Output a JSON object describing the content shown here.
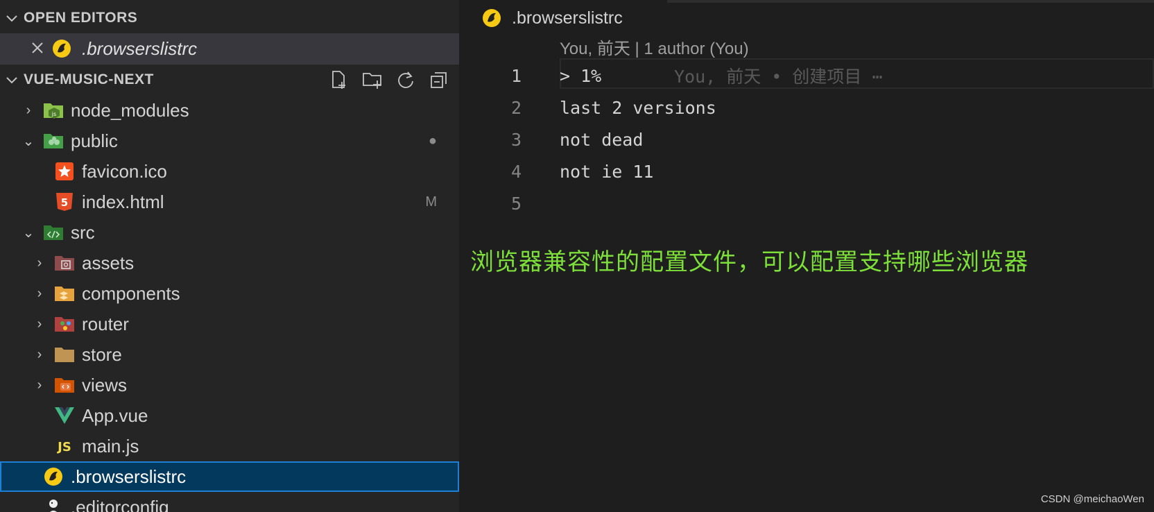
{
  "sidebar": {
    "open_editors": {
      "title": "OPEN EDITORS",
      "items": [
        {
          "label": ".browserslistrc",
          "italic": true
        }
      ]
    },
    "project": {
      "title": "VUE-MUSIC-NEXT",
      "actions": [
        "new-file-icon",
        "new-folder-icon",
        "refresh-icon",
        "collapse-all-icon"
      ]
    },
    "tree": [
      {
        "label": "node_modules",
        "icon": "node-folder-icon",
        "kind": "folder",
        "expanded": false,
        "depth": 0
      },
      {
        "label": "public",
        "icon": "public-folder-icon",
        "kind": "folder",
        "expanded": true,
        "depth": 0,
        "badge": "●"
      },
      {
        "label": "favicon.ico",
        "icon": "favicon-icon",
        "kind": "file",
        "depth": 1
      },
      {
        "label": "index.html",
        "icon": "html5-icon",
        "kind": "file",
        "depth": 1,
        "badge": "M"
      },
      {
        "label": "src",
        "icon": "src-folder-icon",
        "kind": "folder",
        "expanded": true,
        "depth": 0
      },
      {
        "label": "assets",
        "icon": "assets-folder-icon",
        "kind": "folder",
        "expanded": false,
        "depth": 1
      },
      {
        "label": "components",
        "icon": "components-folder-icon",
        "kind": "folder",
        "expanded": false,
        "depth": 1
      },
      {
        "label": "router",
        "icon": "router-folder-icon",
        "kind": "folder",
        "expanded": false,
        "depth": 1
      },
      {
        "label": "store",
        "icon": "folder-icon",
        "kind": "folder",
        "expanded": false,
        "depth": 1
      },
      {
        "label": "views",
        "icon": "views-folder-icon",
        "kind": "folder",
        "expanded": false,
        "depth": 1
      },
      {
        "label": "App.vue",
        "icon": "vue-icon",
        "kind": "file",
        "depth": 1
      },
      {
        "label": "main.js",
        "icon": "js-icon",
        "kind": "file",
        "depth": 1
      },
      {
        "label": ".browserslistrc",
        "icon": "browserslist-icon",
        "kind": "file",
        "depth": 0,
        "selected": true
      },
      {
        "label": ".editorconfig",
        "icon": "editorconfig-icon",
        "kind": "file",
        "depth": 0
      }
    ]
  },
  "editor": {
    "tab_label": ".browserslistrc",
    "blame_header": "You, 前天 | 1 author (You)",
    "inline_blame": "You, 前天 • 创建项目 ⋯",
    "lines": [
      {
        "n": "1",
        "text": "> 1%"
      },
      {
        "n": "2",
        "text": "last 2 versions"
      },
      {
        "n": "3",
        "text": "not dead"
      },
      {
        "n": "4",
        "text": "not ie 11"
      },
      {
        "n": "5",
        "text": ""
      }
    ],
    "annotation": "浏览器兼容性的配置文件，可以配置支持哪些浏览器"
  },
  "watermark": "CSDN @meichaoWen",
  "colors": {
    "sidebar_bg": "#252526",
    "editor_bg": "#1e1e1e",
    "selection_bg": "#04395e",
    "selection_border": "#1e7fd6",
    "annotation_green": "#7ddf3a"
  }
}
